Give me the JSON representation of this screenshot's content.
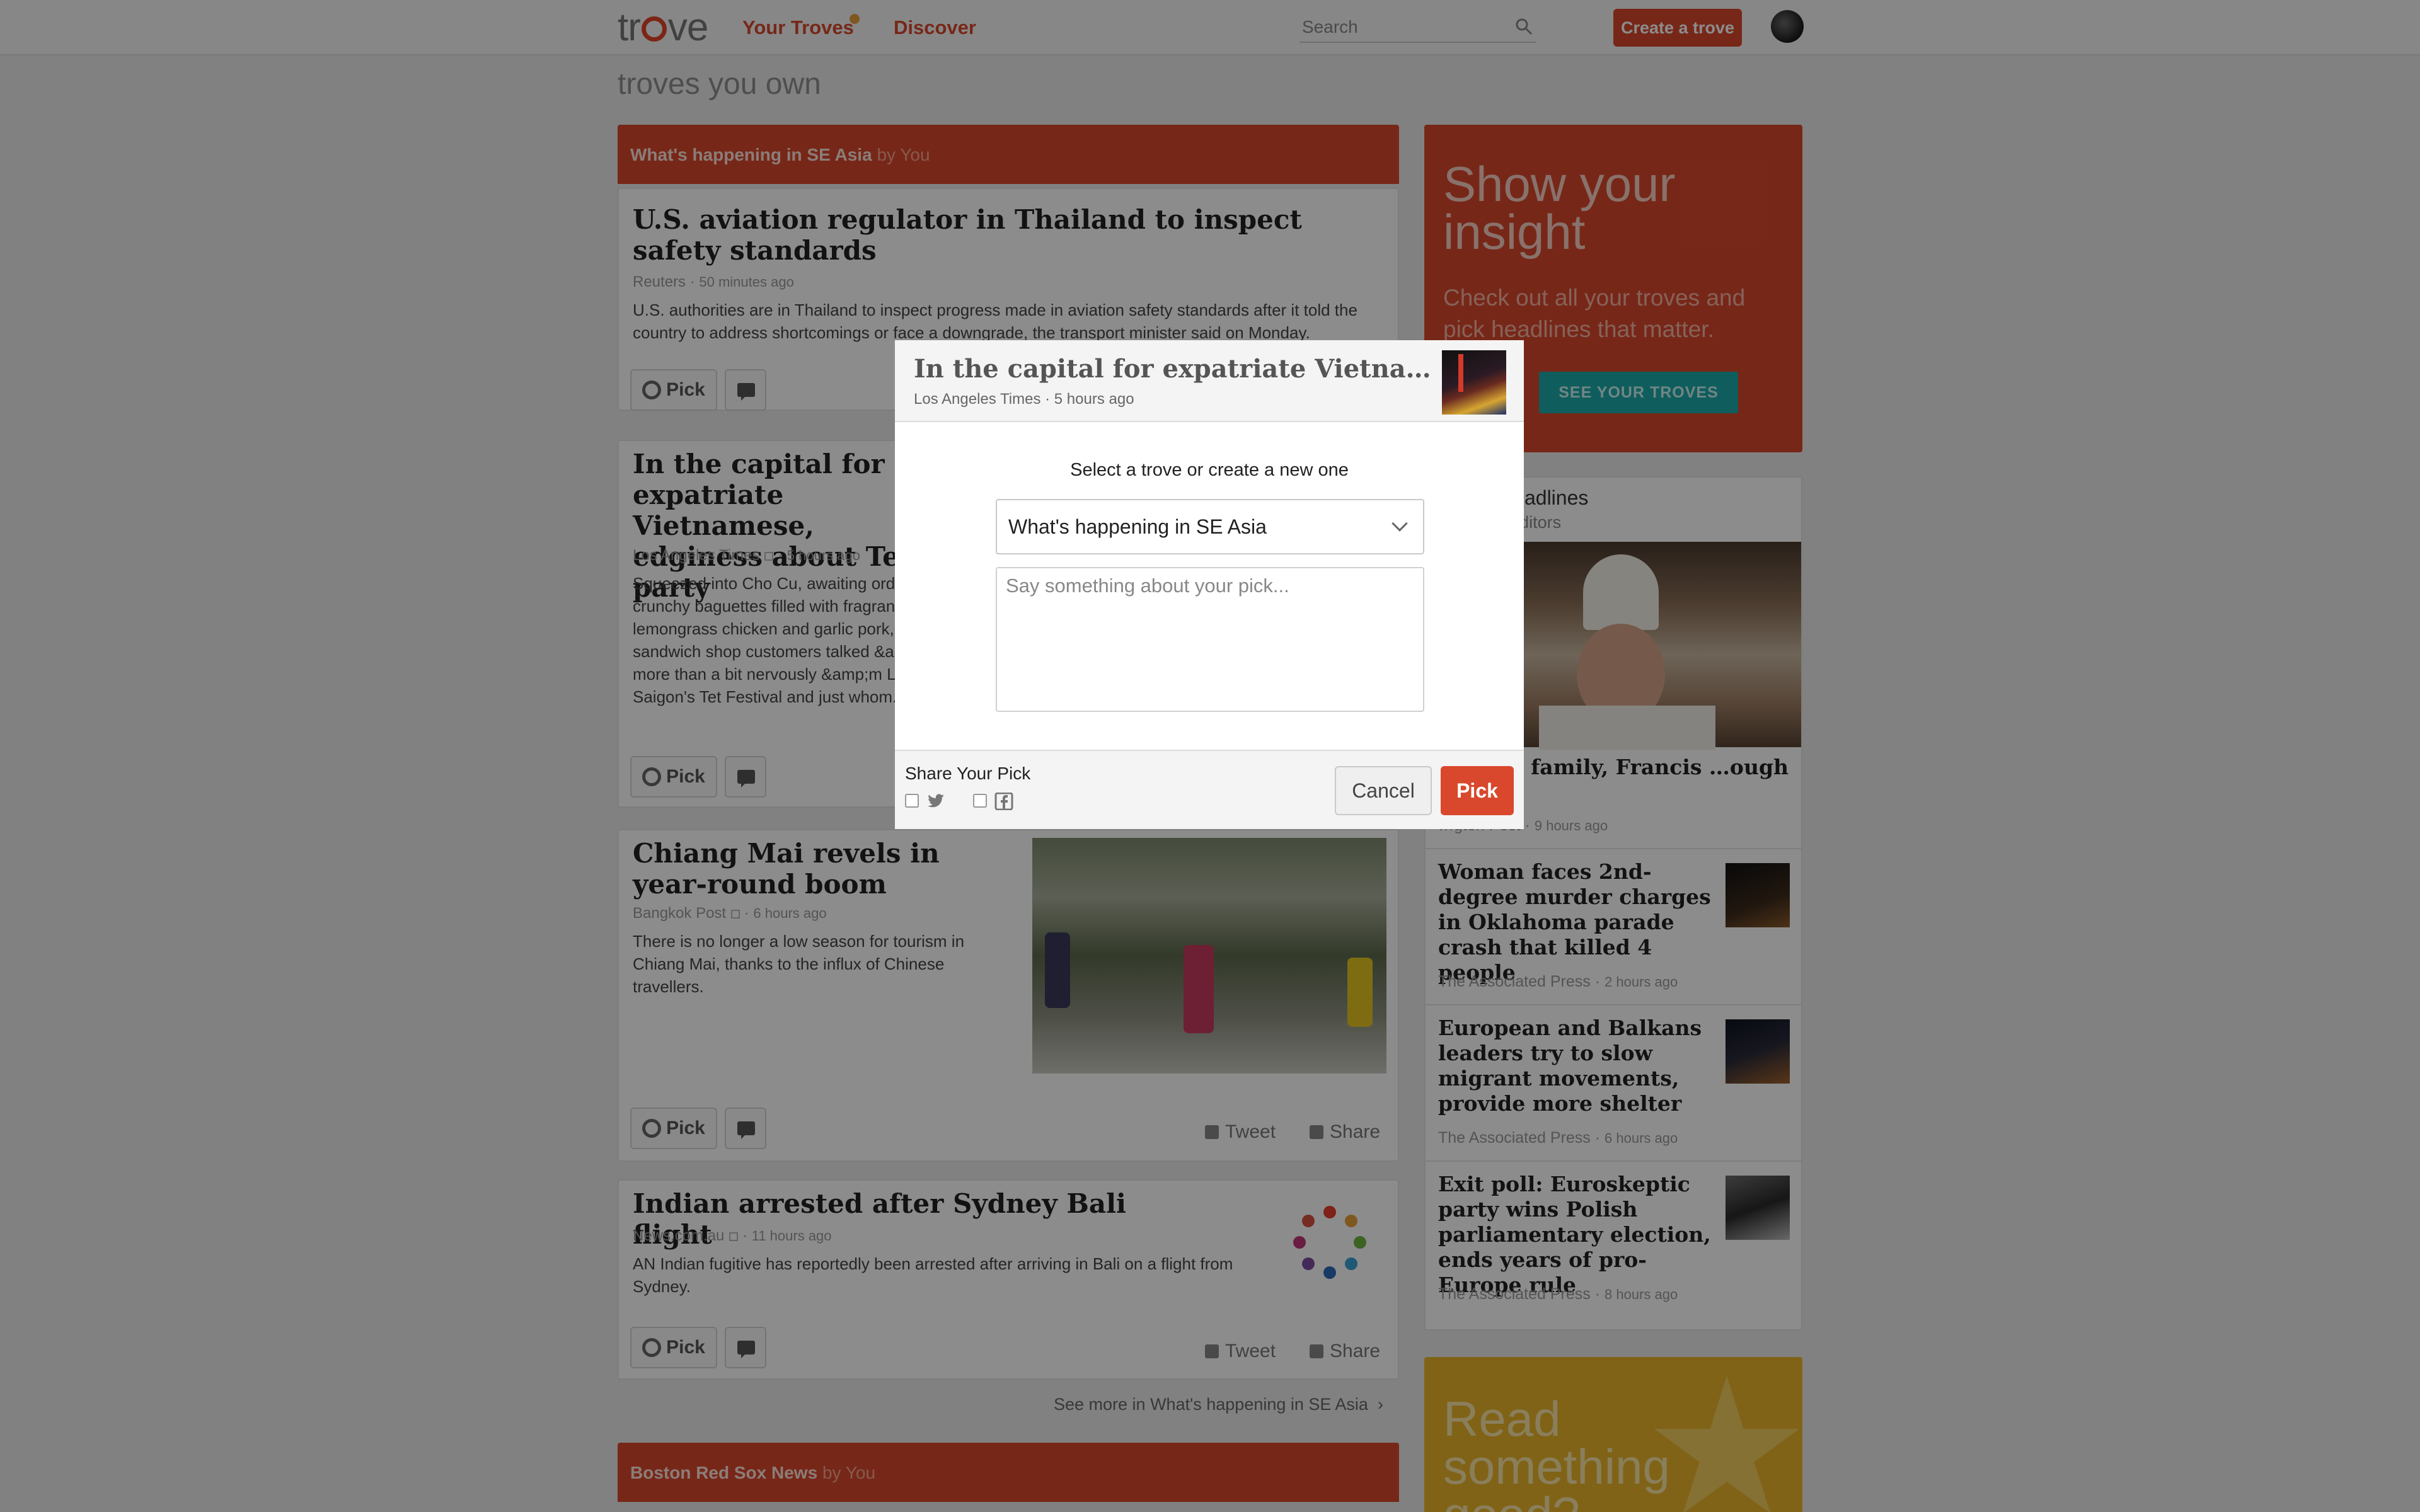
{
  "topbar": {
    "logo": "trove",
    "nav": [
      "Your Troves",
      "Discover"
    ],
    "search_placeholder": "Search",
    "create_label": "Create a trove"
  },
  "section_title": "troves you own",
  "troves": [
    {
      "name": "What's happening in SE Asia",
      "by": "by You"
    },
    {
      "name": "Boston Red Sox News",
      "by": "by You"
    }
  ],
  "articles": [
    {
      "title": "U.S. aviation regulator in Thailand to inspect safety standards",
      "source": "Reuters",
      "time": "50 minutes ago",
      "desc": "U.S. authorities are in Thailand to inspect progress made in aviation safety standards after it told the country to address shortcomings or face a downgrade, the transport minister said on Monday."
    },
    {
      "title": "In the capital for expatriate Vietnamese, edginess about Tet party",
      "source": "Los Angeles Times",
      "time": "5 hours ago",
      "desc": "Squeezed into Cho Cu, awaiting orders of crunchy baguettes filled with fragrant lemongrass chicken and garlic pork, sandwich shop customers talked &amp; more than a bit nervously &amp;m Little Saigon's Tet Festival and just whom."
    },
    {
      "title": "Chiang Mai revels in year-round boom",
      "source": "Bangkok Post",
      "time": "6 hours ago",
      "desc": "There is no longer a low season for tourism in Chiang Mai, thanks to the influx of Chinese travellers."
    },
    {
      "title": "Indian arrested after Sydney Bali flight",
      "source": "News.com.au",
      "time": "11 hours ago",
      "desc": "AN Indian fugitive has reportedly been arrested after arriving in Bali on a flight from Sydney."
    }
  ],
  "actions": {
    "pick": "Pick",
    "tweet": "Tweet",
    "share": "Share"
  },
  "see_more": "See more in What's happening in SE Asia",
  "insight": {
    "title": "Show your insight",
    "body": "Check out all your troves and pick headlines that matter.",
    "button": "SEE YOUR TROVES"
  },
  "latest": {
    "title": "Latest Headlines",
    "subtitle": "by Trove Editors",
    "items": [
      {
        "title": "…od on family, Francis …ough choice",
        "source": "…gton Post",
        "time": "9 hours ago"
      },
      {
        "title": "Woman faces 2nd-degree murder charges in Oklahoma parade crash that killed 4 people",
        "source": "The Associated Press",
        "time": "2 hours ago"
      },
      {
        "title": "European and Balkans leaders try to slow migrant movements, provide more shelter",
        "source": "The Associated Press",
        "time": "6 hours ago"
      },
      {
        "title": "Exit poll: Euroskeptic party wins Polish parliamentary election, ends years of pro-Europe rule",
        "source": "The Associated Press",
        "time": "8 hours ago"
      }
    ]
  },
  "readgood": {
    "title": "Read something good?"
  },
  "modal": {
    "title": "In the capital for expatriate Vietnamese, e…",
    "source": "Los Angeles Times",
    "time": "5 hours ago",
    "prompt": "Select a trove or create a new one",
    "selected_trove": "What's happening in SE Asia",
    "comment_placeholder": "Say something about your pick...",
    "share_label": "Share Your Pick",
    "cancel": "Cancel",
    "pick": "Pick"
  },
  "colors": {
    "brand": "#d9482c",
    "teal": "#1ea9a9",
    "yellow": "#eab52a"
  }
}
